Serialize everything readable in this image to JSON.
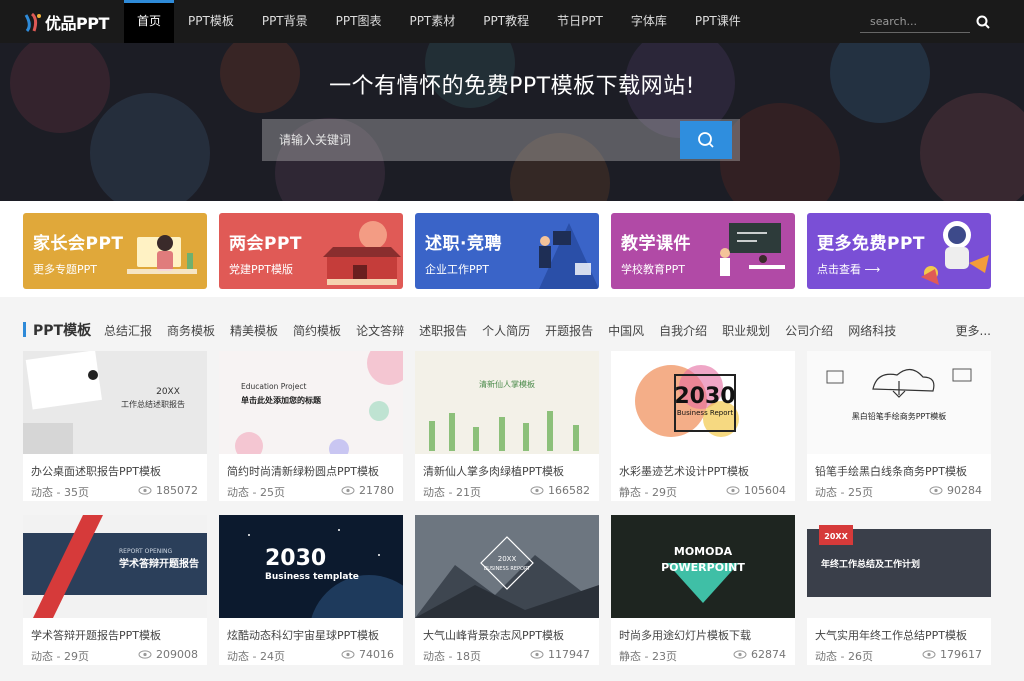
{
  "site": {
    "logo_text": "优品PPT"
  },
  "nav": {
    "items": [
      "首页",
      "PPT模板",
      "PPT背景",
      "PPT图表",
      "PPT素材",
      "PPT教程",
      "节日PPT",
      "字体库",
      "PPT课件"
    ],
    "active_index": 0,
    "search_placeholder": "search..."
  },
  "hero": {
    "title": "一个有情怀的免费PPT模板下载网站!",
    "search_placeholder": "请输入关键词"
  },
  "categories": [
    {
      "title": "家长会PPT",
      "subtitle": "更多专题PPT",
      "color": "#e0a83a"
    },
    {
      "title": "两会PPT",
      "subtitle": "党建PPT模版",
      "color": "#e05a56"
    },
    {
      "title": "述职·竞聘",
      "subtitle": "企业工作PPT",
      "color": "#3a64c8"
    },
    {
      "title": "教学课件",
      "subtitle": "学校教育PPT",
      "color": "#b14aa6"
    },
    {
      "title": "更多免费PPT",
      "subtitle": "点击查看 ⟶",
      "color": "#7a4fd6"
    }
  ],
  "section": {
    "title": "PPT模板",
    "tags": [
      "总结汇报",
      "商务模板",
      "精美模板",
      "简约模板",
      "论文答辩",
      "述职报告",
      "个人简历",
      "开题报告",
      "中国风",
      "自我介绍",
      "职业规划",
      "公司介绍",
      "网络科技"
    ],
    "more": "更多..."
  },
  "cards": [
    {
      "title": "办公桌面述职报告PPT模板",
      "meta": "动态 - 35页",
      "views": "185072",
      "thumb_text": [
        "20XX",
        "工作总结述职报告"
      ]
    },
    {
      "title": "简约时尚清新绿粉圆点PPT模板",
      "meta": "动态 - 25页",
      "views": "21780",
      "thumb_text": [
        "Education Project",
        "单击此处添加您的标题"
      ]
    },
    {
      "title": "清新仙人掌多肉绿植PPT模板",
      "meta": "动态 - 21页",
      "views": "166582",
      "thumb_text": [
        "清新仙人掌模板"
      ]
    },
    {
      "title": "水彩墨迹艺术设计PPT模板",
      "meta": "静态 - 29页",
      "views": "105604",
      "thumb_text": [
        "2030",
        "Business Report"
      ]
    },
    {
      "title": "铅笔手绘黑白线条商务PPT模板",
      "meta": "动态 - 25页",
      "views": "90284",
      "thumb_text": [
        "黑白铅笔手绘商务PPT模板"
      ]
    },
    {
      "title": "学术答辩开题报告PPT模板",
      "meta": "动态 - 29页",
      "views": "209008",
      "thumb_text": [
        "REPORT OPENING",
        "学术答辩开题报告"
      ]
    },
    {
      "title": "炫酷动态科幻宇宙星球PPT模板",
      "meta": "动态 - 24页",
      "views": "74016",
      "thumb_text": [
        "2030",
        "Business template"
      ]
    },
    {
      "title": "大气山峰背景杂志风PPT模板",
      "meta": "动态 - 18页",
      "views": "117947",
      "thumb_text": [
        "20XX",
        "BUSINESS REPORT"
      ]
    },
    {
      "title": "时尚多用途幻灯片模板下载",
      "meta": "静态 - 23页",
      "views": "62874",
      "thumb_text": [
        "MOMODA",
        "POWERPOINT"
      ]
    },
    {
      "title": "大气实用年终工作总结PPT模板",
      "meta": "动态 - 26页",
      "views": "179617",
      "thumb_text": [
        "20XX",
        "年终工作总结及工作计划"
      ]
    }
  ],
  "colors": {
    "accent": "#2e8ad8",
    "topbar": "#1a1a1a"
  }
}
